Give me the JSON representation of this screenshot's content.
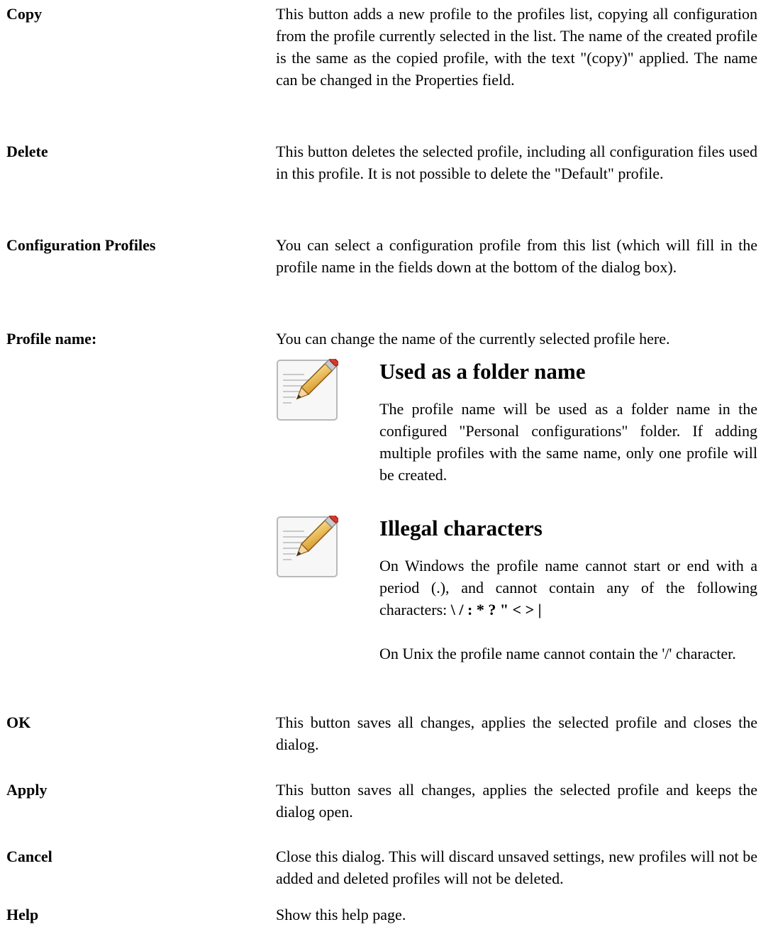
{
  "entries": [
    {
      "term": "Copy",
      "definition": "This button adds a new profile to the profiles list, copying all configuration from the profile currently selected in the list. The name of the created profile is the same as the copied profile, with the text \"(copy)\" applied. The name can be changed in the Properties field."
    },
    {
      "term": "Delete",
      "definition": "This button deletes the selected profile, including all configuration files used in this profile. It is not possible to delete the \"Default\" profile."
    },
    {
      "term": "Configuration Profiles",
      "definition": "You can select a configuration profile from this list (which will fill in the profile name in the fields down at the bottom of the dialog box)."
    },
    {
      "term": "Profile name:",
      "definition": "You can change the name of the currently selected profile here."
    },
    {
      "term": "OK",
      "definition": "This button saves all changes, applies the selected profile and closes the dialog."
    },
    {
      "term": "Apply",
      "definition": "This button saves all changes, applies the selected profile and keeps the dialog open."
    },
    {
      "term": "Cancel",
      "definition": "Close this dialog. This will discard unsaved settings, new profiles will not be added and deleted profiles will not be deleted."
    },
    {
      "term": "Help",
      "definition": "Show this help page."
    }
  ],
  "notes": [
    {
      "icon": "note-pencil-icon",
      "title": "Used as a folder name",
      "body": "The profile name will be used as a folder name in the configured \"Personal configurations\" folder. If adding multiple profiles with the same name, only one profile will be created."
    },
    {
      "icon": "note-pencil-icon",
      "title": "Illegal characters",
      "body_intro": "On Windows the profile name cannot start or end with a period (.), and cannot contain any of the following characters:",
      "body_chars": "\\ / : * ? \" < > |",
      "body_unix": "On Unix the profile name cannot contain the '/' character."
    }
  ]
}
